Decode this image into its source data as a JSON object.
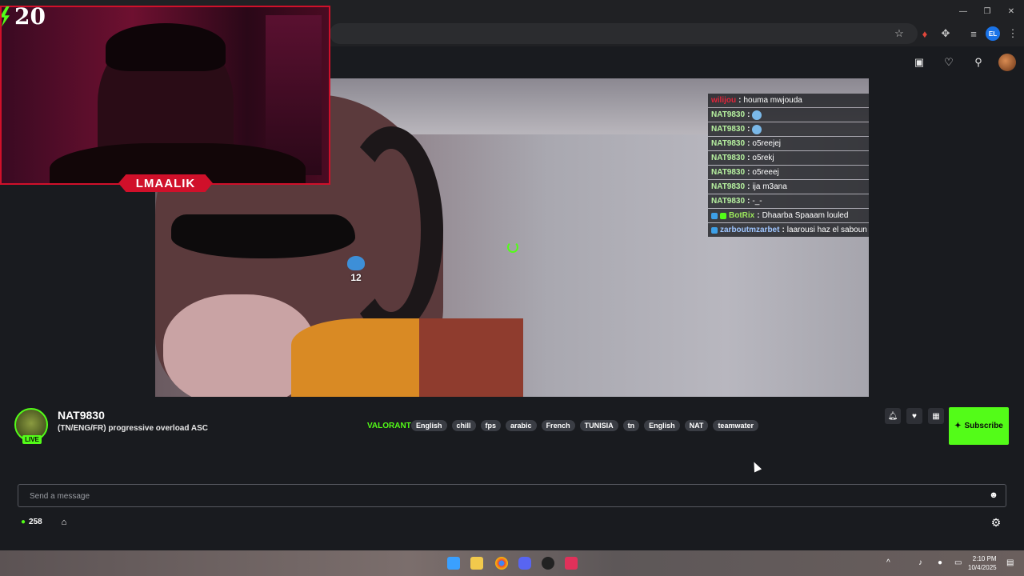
{
  "browser": {
    "window_controls": {
      "minimize": "—",
      "maximize": "❐",
      "close": "✕"
    },
    "profile_initials": "EL"
  },
  "webcam": {
    "counter": "20",
    "label": "LMAALIK"
  },
  "video": {
    "badge_number": "12"
  },
  "chat_overlay": [
    {
      "user": "wilijou",
      "message": "houma mwjouda",
      "color": "red"
    },
    {
      "user": "NAT9830",
      "message": "",
      "emote": true
    },
    {
      "user": "NAT9830",
      "message": "",
      "emote": true
    },
    {
      "user": "NAT9830",
      "message": "o5reejej"
    },
    {
      "user": "NAT9830",
      "message": "o5rekj"
    },
    {
      "user": "NAT9830",
      "message": "o5reeej"
    },
    {
      "user": "NAT9830",
      "message": "ija m3ana"
    },
    {
      "user": "NAT9830",
      "message": "-_-"
    },
    {
      "user": "BotRix",
      "message": "Dhaarba Spaaam louled",
      "color": "green2",
      "badges": 2
    },
    {
      "user": "zarboutmzarbet",
      "message": "laarousi haz el saboun",
      "color": "blue",
      "badges": 1
    }
  ],
  "stream": {
    "channel_name": "NAT9830",
    "title": "(TN/ENG/FR) progressive overload ASC",
    "live_label": "LIVE",
    "category": "VALORANT",
    "tags": [
      "English",
      "chill",
      "fps",
      "arabic",
      "French",
      "TUNISIA",
      "tn",
      "English",
      "NAT",
      "teamwater"
    ],
    "subscribe_label": "Subscribe"
  },
  "chat": {
    "placeholder": "Send a message",
    "viewer_count": "258"
  },
  "taskbar": {
    "time": "2:10 PM",
    "date": "10/4/2025"
  },
  "colors": {
    "accent": "#53fc18",
    "webcam_red": "#d0102a",
    "background": "#191b1f"
  }
}
